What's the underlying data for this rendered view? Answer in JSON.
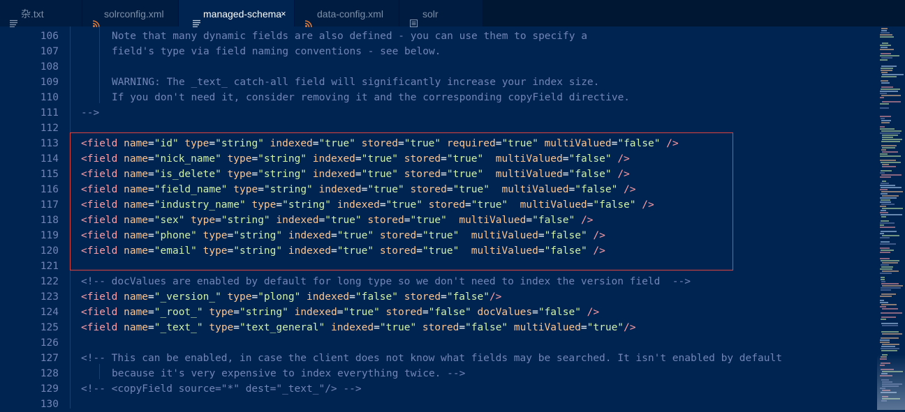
{
  "tabs": [
    {
      "label": "杂.txt",
      "icon": "lines-icon",
      "active": false
    },
    {
      "label": "solrconfig.xml",
      "icon": "rss-icon",
      "active": false
    },
    {
      "label": "managed-schema",
      "icon": "lines-icon",
      "active": true,
      "close": "×"
    },
    {
      "label": "data-config.xml",
      "icon": "rss-icon",
      "active": false
    },
    {
      "label": "solr",
      "icon": "file-icon",
      "active": false
    }
  ],
  "lines": [
    {
      "num": "106",
      "indent": 2,
      "parts": [
        {
          "t": "Note that many dynamic fields are also defined - you can use them to specify a",
          "c": "com"
        }
      ]
    },
    {
      "num": "107",
      "indent": 2,
      "parts": [
        {
          "t": "field's type via field naming conventions - see below.",
          "c": "com"
        }
      ]
    },
    {
      "num": "108",
      "indent": 2,
      "parts": []
    },
    {
      "num": "109",
      "indent": 2,
      "parts": [
        {
          "t": "WARNING: The _text_ catch-all field will significantly increase your index size.",
          "c": "com"
        }
      ]
    },
    {
      "num": "110",
      "indent": 2,
      "parts": [
        {
          "t": "If you don't need it, consider removing it and the corresponding copyField directive.",
          "c": "com"
        }
      ]
    },
    {
      "num": "111",
      "indent": 0,
      "parts": [
        {
          "t": "-->",
          "c": "com"
        }
      ]
    },
    {
      "num": "112",
      "indent": 0,
      "parts": []
    },
    {
      "num": "113",
      "indent": 0,
      "parts": [
        {
          "t": "<field",
          "c": "tag"
        },
        {
          "t": " name",
          "c": "attr"
        },
        {
          "t": "=",
          "c": "eq"
        },
        {
          "t": "\"id\"",
          "c": "str"
        },
        {
          "t": " type",
          "c": "attr"
        },
        {
          "t": "=",
          "c": "eq"
        },
        {
          "t": "\"string\"",
          "c": "str"
        },
        {
          "t": " indexed",
          "c": "attr"
        },
        {
          "t": "=",
          "c": "eq"
        },
        {
          "t": "\"true\"",
          "c": "str"
        },
        {
          "t": " stored",
          "c": "attr"
        },
        {
          "t": "=",
          "c": "eq"
        },
        {
          "t": "\"true\"",
          "c": "str"
        },
        {
          "t": " required",
          "c": "attr"
        },
        {
          "t": "=",
          "c": "eq"
        },
        {
          "t": "\"true\"",
          "c": "str"
        },
        {
          "t": " multiValued",
          "c": "attr"
        },
        {
          "t": "=",
          "c": "eq"
        },
        {
          "t": "\"false\"",
          "c": "str"
        },
        {
          "t": " />",
          "c": "tag"
        }
      ]
    },
    {
      "num": "114",
      "indent": 0,
      "parts": [
        {
          "t": "<field",
          "c": "tag"
        },
        {
          "t": " name",
          "c": "attr"
        },
        {
          "t": "=",
          "c": "eq"
        },
        {
          "t": "\"nick_name\"",
          "c": "str"
        },
        {
          "t": " type",
          "c": "attr"
        },
        {
          "t": "=",
          "c": "eq"
        },
        {
          "t": "\"string\"",
          "c": "str"
        },
        {
          "t": " indexed",
          "c": "attr"
        },
        {
          "t": "=",
          "c": "eq"
        },
        {
          "t": "\"true\"",
          "c": "str"
        },
        {
          "t": " stored",
          "c": "attr"
        },
        {
          "t": "=",
          "c": "eq"
        },
        {
          "t": "\"true\"",
          "c": "str"
        },
        {
          "t": "  multiValued",
          "c": "attr"
        },
        {
          "t": "=",
          "c": "eq"
        },
        {
          "t": "\"false\"",
          "c": "str"
        },
        {
          "t": " />",
          "c": "tag"
        }
      ]
    },
    {
      "num": "115",
      "indent": 0,
      "parts": [
        {
          "t": "<field",
          "c": "tag"
        },
        {
          "t": " name",
          "c": "attr"
        },
        {
          "t": "=",
          "c": "eq"
        },
        {
          "t": "\"is_delete\"",
          "c": "str"
        },
        {
          "t": " type",
          "c": "attr"
        },
        {
          "t": "=",
          "c": "eq"
        },
        {
          "t": "\"string\"",
          "c": "str"
        },
        {
          "t": " indexed",
          "c": "attr"
        },
        {
          "t": "=",
          "c": "eq"
        },
        {
          "t": "\"true\"",
          "c": "str"
        },
        {
          "t": " stored",
          "c": "attr"
        },
        {
          "t": "=",
          "c": "eq"
        },
        {
          "t": "\"true\"",
          "c": "str"
        },
        {
          "t": "  multiValued",
          "c": "attr"
        },
        {
          "t": "=",
          "c": "eq"
        },
        {
          "t": "\"false\"",
          "c": "str"
        },
        {
          "t": " />",
          "c": "tag"
        }
      ]
    },
    {
      "num": "116",
      "indent": 0,
      "parts": [
        {
          "t": "<field",
          "c": "tag"
        },
        {
          "t": " name",
          "c": "attr"
        },
        {
          "t": "=",
          "c": "eq"
        },
        {
          "t": "\"field_name\"",
          "c": "str"
        },
        {
          "t": " type",
          "c": "attr"
        },
        {
          "t": "=",
          "c": "eq"
        },
        {
          "t": "\"string\"",
          "c": "str"
        },
        {
          "t": " indexed",
          "c": "attr"
        },
        {
          "t": "=",
          "c": "eq"
        },
        {
          "t": "\"true\"",
          "c": "str"
        },
        {
          "t": " stored",
          "c": "attr"
        },
        {
          "t": "=",
          "c": "eq"
        },
        {
          "t": "\"true\"",
          "c": "str"
        },
        {
          "t": "  multiValued",
          "c": "attr"
        },
        {
          "t": "=",
          "c": "eq"
        },
        {
          "t": "\"false\"",
          "c": "str"
        },
        {
          "t": " />",
          "c": "tag"
        }
      ]
    },
    {
      "num": "117",
      "indent": 0,
      "parts": [
        {
          "t": "<field",
          "c": "tag"
        },
        {
          "t": " name",
          "c": "attr"
        },
        {
          "t": "=",
          "c": "eq"
        },
        {
          "t": "\"industry_name\"",
          "c": "str"
        },
        {
          "t": " type",
          "c": "attr"
        },
        {
          "t": "=",
          "c": "eq"
        },
        {
          "t": "\"string\"",
          "c": "str"
        },
        {
          "t": " indexed",
          "c": "attr"
        },
        {
          "t": "=",
          "c": "eq"
        },
        {
          "t": "\"true\"",
          "c": "str"
        },
        {
          "t": " stored",
          "c": "attr"
        },
        {
          "t": "=",
          "c": "eq"
        },
        {
          "t": "\"true\"",
          "c": "str"
        },
        {
          "t": "  multiValued",
          "c": "attr"
        },
        {
          "t": "=",
          "c": "eq"
        },
        {
          "t": "\"false\"",
          "c": "str"
        },
        {
          "t": " />",
          "c": "tag"
        }
      ]
    },
    {
      "num": "118",
      "indent": 0,
      "parts": [
        {
          "t": "<field",
          "c": "tag"
        },
        {
          "t": " name",
          "c": "attr"
        },
        {
          "t": "=",
          "c": "eq"
        },
        {
          "t": "\"sex\"",
          "c": "str"
        },
        {
          "t": " type",
          "c": "attr"
        },
        {
          "t": "=",
          "c": "eq"
        },
        {
          "t": "\"string\"",
          "c": "str"
        },
        {
          "t": " indexed",
          "c": "attr"
        },
        {
          "t": "=",
          "c": "eq"
        },
        {
          "t": "\"true\"",
          "c": "str"
        },
        {
          "t": " stored",
          "c": "attr"
        },
        {
          "t": "=",
          "c": "eq"
        },
        {
          "t": "\"true\"",
          "c": "str"
        },
        {
          "t": "  multiValued",
          "c": "attr"
        },
        {
          "t": "=",
          "c": "eq"
        },
        {
          "t": "\"false\"",
          "c": "str"
        },
        {
          "t": " />",
          "c": "tag"
        }
      ]
    },
    {
      "num": "119",
      "indent": 0,
      "parts": [
        {
          "t": "<field",
          "c": "tag"
        },
        {
          "t": " name",
          "c": "attr"
        },
        {
          "t": "=",
          "c": "eq"
        },
        {
          "t": "\"phone\"",
          "c": "str"
        },
        {
          "t": " type",
          "c": "attr"
        },
        {
          "t": "=",
          "c": "eq"
        },
        {
          "t": "\"string\"",
          "c": "str"
        },
        {
          "t": " indexed",
          "c": "attr"
        },
        {
          "t": "=",
          "c": "eq"
        },
        {
          "t": "\"true\"",
          "c": "str"
        },
        {
          "t": " stored",
          "c": "attr"
        },
        {
          "t": "=",
          "c": "eq"
        },
        {
          "t": "\"true\"",
          "c": "str"
        },
        {
          "t": "  multiValued",
          "c": "attr"
        },
        {
          "t": "=",
          "c": "eq"
        },
        {
          "t": "\"false\"",
          "c": "str"
        },
        {
          "t": " />",
          "c": "tag"
        }
      ]
    },
    {
      "num": "120",
      "indent": 0,
      "parts": [
        {
          "t": "<field",
          "c": "tag"
        },
        {
          "t": " name",
          "c": "attr"
        },
        {
          "t": "=",
          "c": "eq"
        },
        {
          "t": "\"email\"",
          "c": "str"
        },
        {
          "t": " type",
          "c": "attr"
        },
        {
          "t": "=",
          "c": "eq"
        },
        {
          "t": "\"string\"",
          "c": "str"
        },
        {
          "t": " indexed",
          "c": "attr"
        },
        {
          "t": "=",
          "c": "eq"
        },
        {
          "t": "\"true\"",
          "c": "str"
        },
        {
          "t": " stored",
          "c": "attr"
        },
        {
          "t": "=",
          "c": "eq"
        },
        {
          "t": "\"true\"",
          "c": "str"
        },
        {
          "t": "  multiValued",
          "c": "attr"
        },
        {
          "t": "=",
          "c": "eq"
        },
        {
          "t": "\"false\"",
          "c": "str"
        },
        {
          "t": " />",
          "c": "tag"
        }
      ]
    },
    {
      "num": "121",
      "indent": 0,
      "parts": []
    },
    {
      "num": "122",
      "indent": 0,
      "parts": [
        {
          "t": "<!-- docValues are enabled by default for long type so we don't need to index the version field  -->",
          "c": "com"
        }
      ]
    },
    {
      "num": "123",
      "indent": 0,
      "parts": [
        {
          "t": "<field",
          "c": "tag"
        },
        {
          "t": " name",
          "c": "attr"
        },
        {
          "t": "=",
          "c": "eq"
        },
        {
          "t": "\"_version_\"",
          "c": "str"
        },
        {
          "t": " type",
          "c": "attr"
        },
        {
          "t": "=",
          "c": "eq"
        },
        {
          "t": "\"plong\"",
          "c": "str"
        },
        {
          "t": " indexed",
          "c": "attr"
        },
        {
          "t": "=",
          "c": "eq"
        },
        {
          "t": "\"false\"",
          "c": "str"
        },
        {
          "t": " stored",
          "c": "attr"
        },
        {
          "t": "=",
          "c": "eq"
        },
        {
          "t": "\"false\"",
          "c": "str"
        },
        {
          "t": "/>",
          "c": "tag"
        }
      ]
    },
    {
      "num": "124",
      "indent": 0,
      "parts": [
        {
          "t": "<field",
          "c": "tag"
        },
        {
          "t": " name",
          "c": "attr"
        },
        {
          "t": "=",
          "c": "eq"
        },
        {
          "t": "\"_root_\"",
          "c": "str"
        },
        {
          "t": " type",
          "c": "attr"
        },
        {
          "t": "=",
          "c": "eq"
        },
        {
          "t": "\"string\"",
          "c": "str"
        },
        {
          "t": " indexed",
          "c": "attr"
        },
        {
          "t": "=",
          "c": "eq"
        },
        {
          "t": "\"true\"",
          "c": "str"
        },
        {
          "t": " stored",
          "c": "attr"
        },
        {
          "t": "=",
          "c": "eq"
        },
        {
          "t": "\"false\"",
          "c": "str"
        },
        {
          "t": " docValues",
          "c": "attr"
        },
        {
          "t": "=",
          "c": "eq"
        },
        {
          "t": "\"false\"",
          "c": "str"
        },
        {
          "t": " />",
          "c": "tag"
        }
      ]
    },
    {
      "num": "125",
      "indent": 0,
      "parts": [
        {
          "t": "<field",
          "c": "tag"
        },
        {
          "t": " name",
          "c": "attr"
        },
        {
          "t": "=",
          "c": "eq"
        },
        {
          "t": "\"_text_\"",
          "c": "str"
        },
        {
          "t": " type",
          "c": "attr"
        },
        {
          "t": "=",
          "c": "eq"
        },
        {
          "t": "\"text_general\"",
          "c": "str"
        },
        {
          "t": " indexed",
          "c": "attr"
        },
        {
          "t": "=",
          "c": "eq"
        },
        {
          "t": "\"true\"",
          "c": "str"
        },
        {
          "t": " stored",
          "c": "attr"
        },
        {
          "t": "=",
          "c": "eq"
        },
        {
          "t": "\"false\"",
          "c": "str"
        },
        {
          "t": " multiValued",
          "c": "attr"
        },
        {
          "t": "=",
          "c": "eq"
        },
        {
          "t": "\"true\"",
          "c": "str"
        },
        {
          "t": "/>",
          "c": "tag"
        }
      ]
    },
    {
      "num": "126",
      "indent": 0,
      "parts": []
    },
    {
      "num": "127",
      "indent": 0,
      "parts": [
        {
          "t": "<!-- This can be enabled, in case the client does not know what fields may be searched. It isn't enabled by default",
          "c": "com"
        }
      ]
    },
    {
      "num": "128",
      "indent": 2,
      "parts": [
        {
          "t": "because it's very expensive to index everything twice. -->",
          "c": "com"
        }
      ]
    },
    {
      "num": "129",
      "indent": 0,
      "parts": [
        {
          "t": "<!-- <copyField source=\"*\" dest=\"_text_\"/> -->",
          "c": "com"
        }
      ]
    },
    {
      "num": "130",
      "indent": 0,
      "parts": []
    }
  ]
}
